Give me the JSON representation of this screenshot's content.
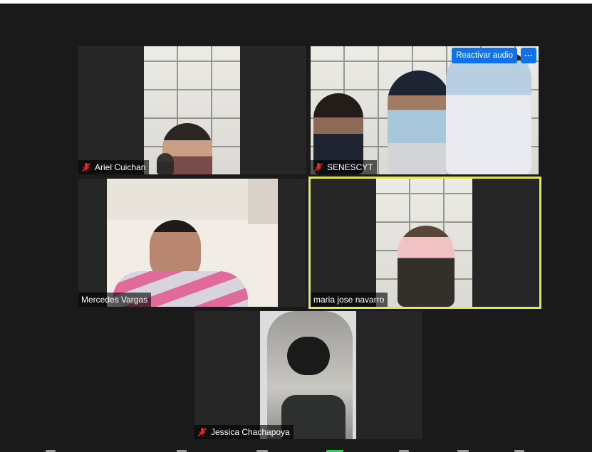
{
  "participants": [
    {
      "name": "Ariel Cuichan",
      "muted": true
    },
    {
      "name": "SENESCYT",
      "muted": true
    },
    {
      "name": "Mercedes Vargas",
      "muted": false
    },
    {
      "name": "maria jose navarro",
      "muted": false,
      "active_speaker": true
    },
    {
      "name": "Jessica Chachapoya",
      "muted": true
    }
  ],
  "tile_controls": {
    "unmute_label": "Reactivar audio",
    "more_label": "···"
  },
  "colors": {
    "background": "#1a1a1a",
    "tile": "#262626",
    "accent_blue": "#0e72ed",
    "active_speaker_border": "#e0e85a",
    "mute_red": "#e02828"
  },
  "icons": [
    "muted-mic-icon",
    "more-options-icon"
  ]
}
